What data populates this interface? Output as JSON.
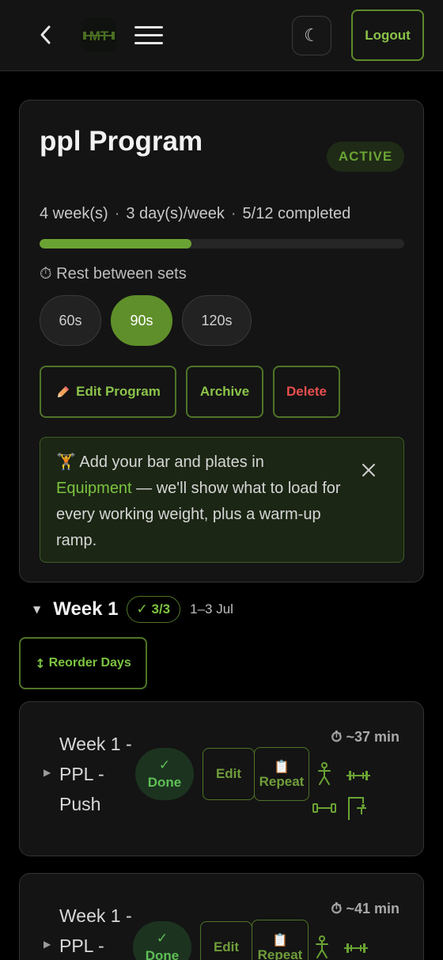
{
  "header": {
    "logo_text": "MT",
    "theme_icon": "moon-icon",
    "logout_label": "Logout"
  },
  "program": {
    "title": "ppl Program",
    "status": "ACTIVE",
    "weeks": "4 week(s)",
    "days_per_week": "3 day(s)/week",
    "completed": "5/12 completed",
    "progress_fraction": 0.4167,
    "rest_label": "Rest between sets",
    "rest_options": [
      "60s",
      "90s",
      "120s"
    ],
    "rest_selected": "90s",
    "actions": {
      "edit": "Edit Program",
      "archive": "Archive",
      "delete": "Delete"
    },
    "tip": {
      "before": "Add your bar and plates in ",
      "link": "Equipment",
      "after": " — we'll show what to load for every working weight, plus a warm-up ramp."
    }
  },
  "week": {
    "title": "Week 1",
    "badge": "✓ 3/3",
    "dates": "1–3 Jul",
    "reorder_label": "Reorder Days"
  },
  "days": [
    {
      "name": "Week 1 - PPL - Push",
      "done_check": "✓",
      "done_label": "Done",
      "edit_label": "Edit",
      "repeat_label": "Repeat",
      "duration": "~37 min",
      "equipment_icons": [
        "bodyweight-icon",
        "barbell-icon",
        "dumbbell-icon",
        "cable-machine-icon"
      ]
    },
    {
      "name": "Week 1 - PPL - ",
      "done_check": "✓",
      "done_label": "Done",
      "edit_label": "Edit",
      "repeat_label": "Repeat",
      "duration": "~41 min",
      "equipment_icons": [
        "bodyweight-icon",
        "barbell-icon"
      ]
    }
  ],
  "colors": {
    "accent": "#6aa334",
    "accent_text": "#8bc34a",
    "danger": "#e84e4e",
    "done_bg": "#1c3320"
  }
}
